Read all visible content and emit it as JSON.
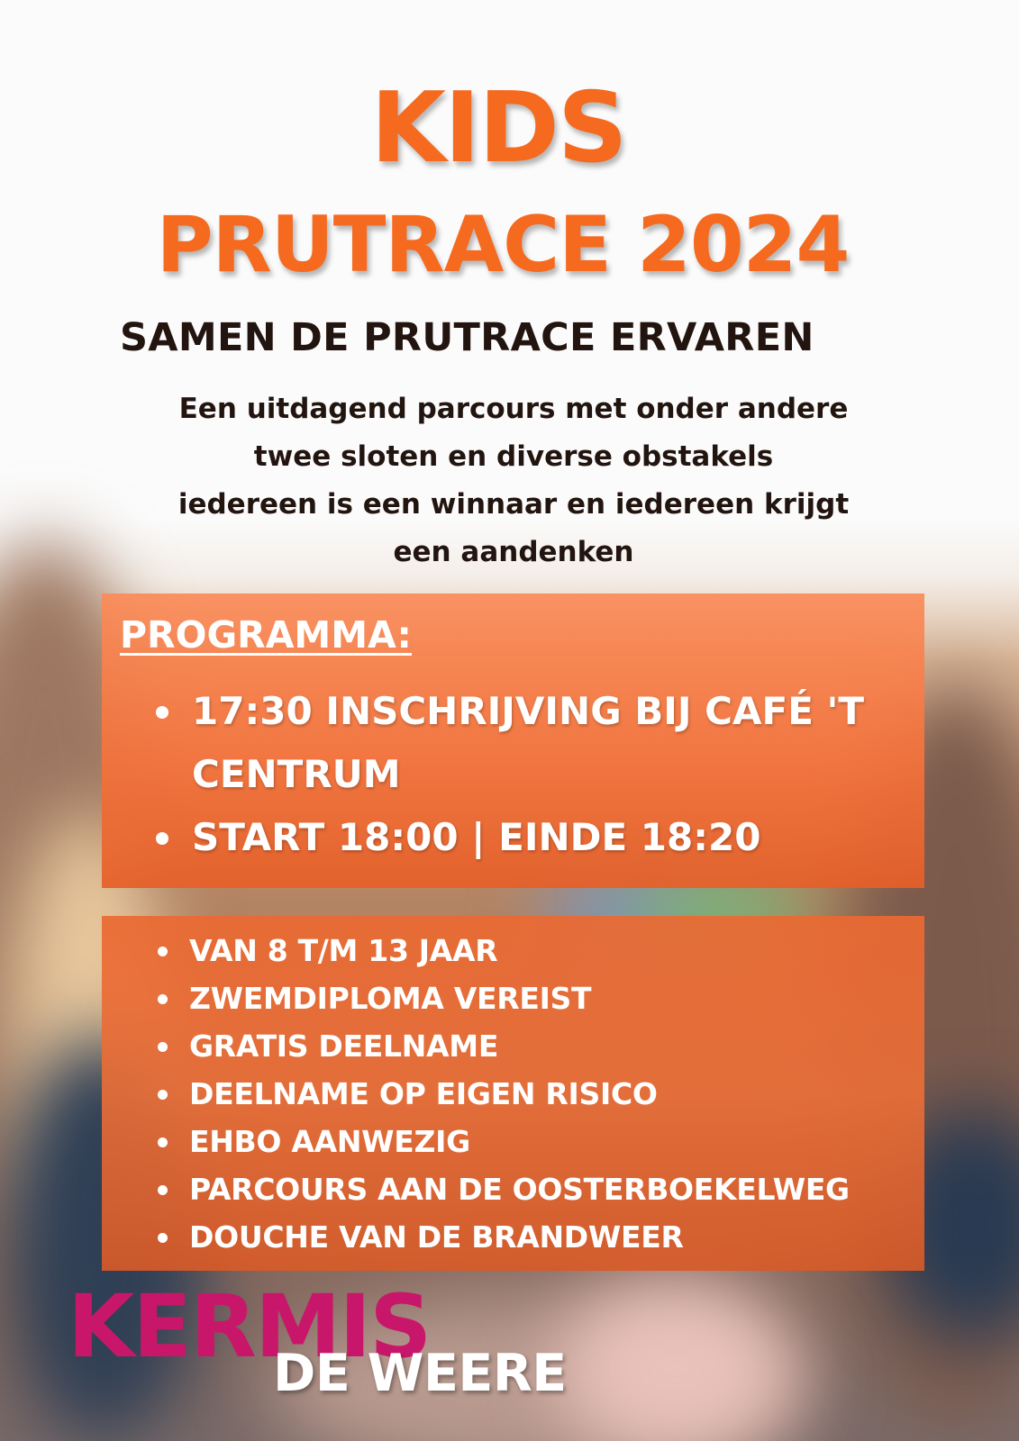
{
  "header": {
    "title_line1": "KIDS",
    "title_line2": "PRUTRACE 2024",
    "subtitle": "SAMEN DE PRUTRACE ERVAREN"
  },
  "description": {
    "lines": [
      "Een uitdagend parcours met onder andere",
      "twee sloten en diverse obstakels",
      "iedereen is een winnaar en iedereen krijgt",
      "een aandenken"
    ]
  },
  "program": {
    "heading": "PROGRAMMA:",
    "items": [
      "17:30 INSCHRIJVING BIJ CAFÉ 'T CENTRUM",
      "START 18:00 | EINDE 18:20"
    ]
  },
  "info": {
    "items": [
      "VAN 8 T/M 13 JAAR",
      "ZWEMDIPLOMA VEREIST",
      "GRATIS DEELNAME",
      "DEELNAME OP EIGEN RISICO",
      "EHBO AANWEZIG",
      "PARCOURS AAN DE OOSTERBOEKELWEG",
      "DOUCHE VAN DE BRANDWEER"
    ]
  },
  "logo": {
    "word1": "KERMIS",
    "word2": "DE WEERE"
  },
  "colors": {
    "title_orange": "#f56a1f",
    "text_dark": "#22140f",
    "panel_orange": "#f0743a",
    "logo_magenta": "#c8176b",
    "white": "#ffffff"
  }
}
